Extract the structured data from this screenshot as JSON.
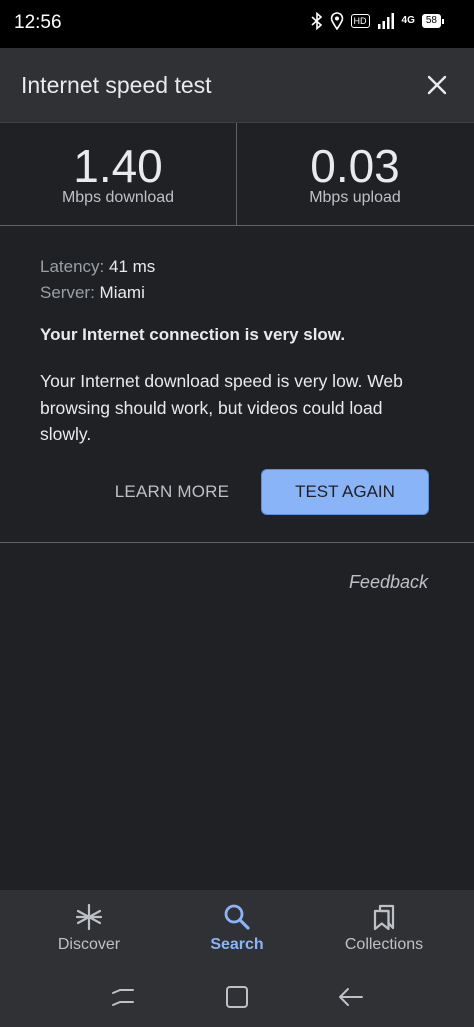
{
  "status_bar": {
    "time": "12:56",
    "icons": [
      "bluetooth-icon",
      "location-icon",
      "hd-badge",
      "signal-icon",
      "network-4g-icon",
      "battery-icon"
    ],
    "hd_label": "HD",
    "network_label": "4G",
    "battery_level": "58"
  },
  "header": {
    "title": "Internet speed test",
    "close_icon": "close-icon"
  },
  "results": {
    "download_value": "1.40",
    "download_label": "Mbps download",
    "upload_value": "0.03",
    "upload_label": "Mbps upload"
  },
  "details": {
    "latency_label": "Latency:",
    "latency_value": "41 ms",
    "server_label": "Server:",
    "server_value": "Miami"
  },
  "summary": {
    "headline": "Your Internet connection is very slow.",
    "description": "Your Internet download speed is very low. Web browsing should work, but videos could load slowly."
  },
  "actions": {
    "learn_more": "LEARN MORE",
    "test_again": "TEST AGAIN",
    "feedback": "Feedback"
  },
  "bottom_nav": {
    "items": [
      {
        "label": "Discover",
        "icon": "asterisk-icon"
      },
      {
        "label": "Search",
        "icon": "search-icon",
        "active": true
      },
      {
        "label": "Collections",
        "icon": "bookmarks-icon"
      }
    ]
  },
  "colors": {
    "background": "#202124",
    "surface": "#303134",
    "accent": "#8ab4f8",
    "text_primary": "#e8eaed",
    "text_secondary": "#bdc1c6"
  }
}
